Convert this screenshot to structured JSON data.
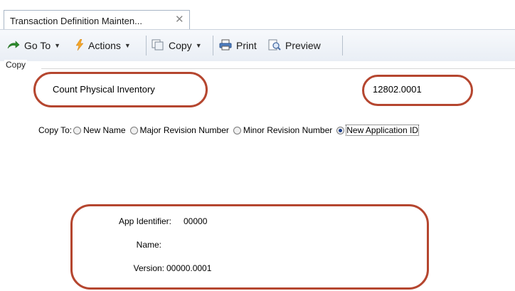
{
  "tab": {
    "title": "Transaction Definition Mainten...",
    "close_glyph": "✕"
  },
  "toolbar": {
    "goto_label": "Go To",
    "actions_label": "Actions",
    "copy_label": "Copy",
    "print_label": "Print",
    "preview_label": "Preview"
  },
  "group": {
    "label": "Copy"
  },
  "source": {
    "name": "Count Physical Inventory",
    "version": "12802.0001"
  },
  "copy_to": {
    "label": "Copy To:",
    "options": [
      {
        "label": "New Name",
        "selected": false
      },
      {
        "label": "Major Revision Number",
        "selected": false
      },
      {
        "label": "Minor Revision Number",
        "selected": false
      },
      {
        "label": "New Application ID",
        "selected": true
      }
    ]
  },
  "target": {
    "app_identifier_label": "App Identifier:",
    "app_identifier_value": "00000",
    "name_label": "Name:",
    "name_value": "",
    "version_label": "Version:",
    "version_value": "00000.0001"
  },
  "colors": {
    "highlight": "#b5462f",
    "accent": "#1c3f8c"
  }
}
